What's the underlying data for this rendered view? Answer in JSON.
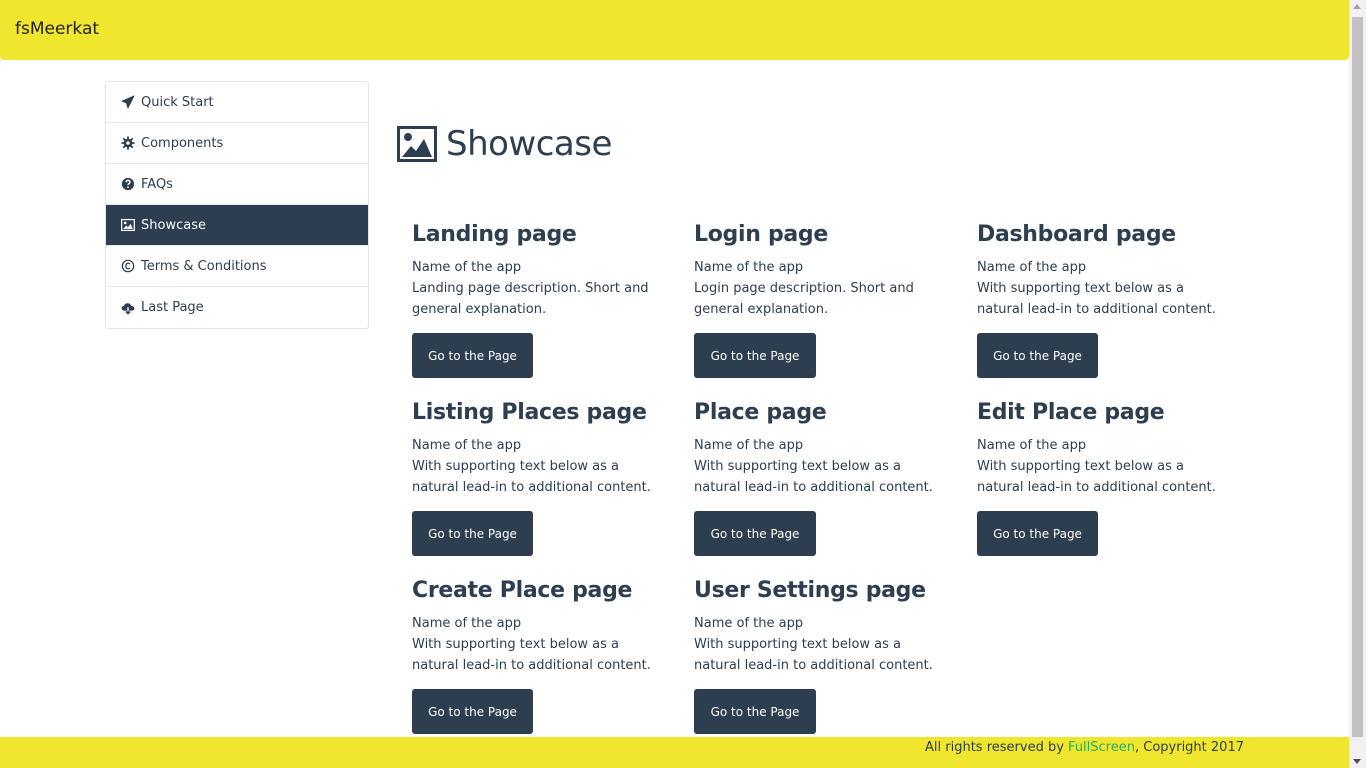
{
  "app": {
    "brand": "fsMeerkat"
  },
  "sidebar": {
    "items": [
      {
        "label": "Quick Start",
        "icon": "paper-plane-icon"
      },
      {
        "label": "Components",
        "icon": "gear-icon"
      },
      {
        "label": "FAQs",
        "icon": "question-circle-icon"
      },
      {
        "label": "Showcase",
        "icon": "image-icon",
        "active": true
      },
      {
        "label": "Terms & Conditions",
        "icon": "copyright-icon"
      },
      {
        "label": "Last Page",
        "icon": "cloud-download-icon"
      }
    ]
  },
  "main": {
    "title": "Showcase",
    "title_icon": "image-icon",
    "cards": [
      {
        "title": "Landing page",
        "subtitle": "Name of the app",
        "text": "Landing page description. Short and general explanation.",
        "button": "Go to the Page"
      },
      {
        "title": "Login page",
        "subtitle": "Name of the app",
        "text": "Login page description. Short and general explanation.",
        "button": "Go to the Page"
      },
      {
        "title": "Dashboard page",
        "subtitle": "Name of the app",
        "text": "With supporting text below as a natural lead-in to additional content.",
        "button": "Go to the Page"
      },
      {
        "title": "Listing Places page",
        "subtitle": "Name of the app",
        "text": "With supporting text below as a natural lead-in to additional content.",
        "button": "Go to the Page"
      },
      {
        "title": "Place page",
        "subtitle": "Name of the app",
        "text": "With supporting text below as a natural lead-in to additional content.",
        "button": "Go to the Page"
      },
      {
        "title": "Edit Place page",
        "subtitle": "Name of the app",
        "text": "With supporting text below as a natural lead-in to additional content.",
        "button": "Go to the Page"
      },
      {
        "title": "Create Place page",
        "subtitle": "Name of the app",
        "text": "With supporting text below as a natural lead-in to additional content.",
        "button": "Go to the Page"
      },
      {
        "title": "User Settings page",
        "subtitle": "Name of the app",
        "text": "With supporting text below as a natural lead-in to additional content.",
        "button": "Go to the Page"
      }
    ]
  },
  "footer": {
    "prefix": "All rights reserved by ",
    "link": "FullScreen",
    "suffix": ", Copyright 2017"
  },
  "colors": {
    "header_bg": "#f0e62e",
    "primary": "#2c3e50",
    "link": "#27ae60"
  }
}
